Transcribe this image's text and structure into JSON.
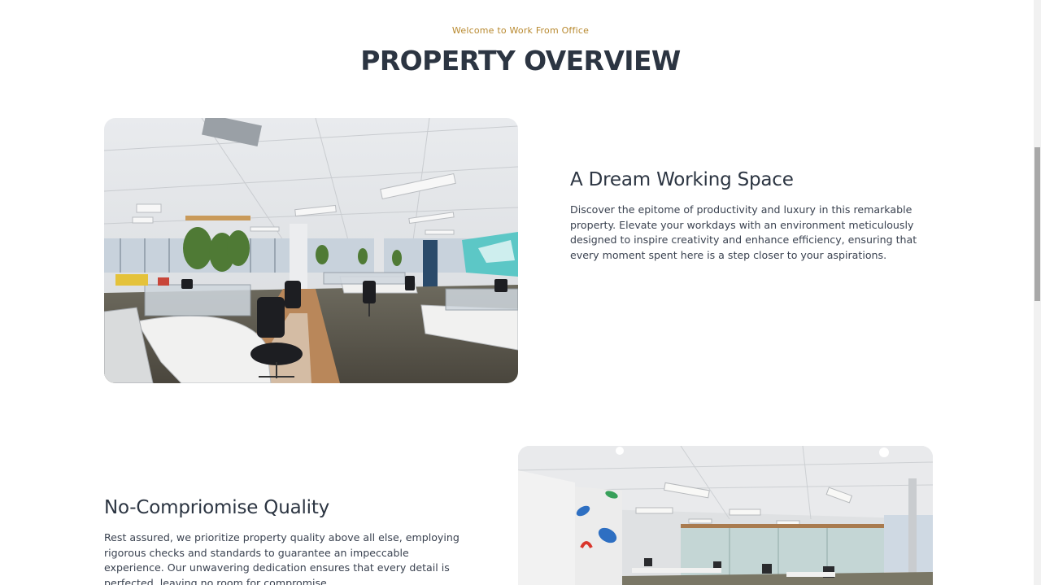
{
  "section": {
    "eyebrow": "Welcome to Work From Office",
    "title": "PROPERTY OVERVIEW"
  },
  "features": [
    {
      "title": "A Dream Working Space",
      "text": "Discover the epitome of productivity and luxury in this remarkable property. Elevate your workdays with an environment meticulously designed to inspire creativity and enhance efficiency, ensuring that every moment spent here is a step closer to your aspirations."
    },
    {
      "title": "No-Compriomise Quality",
      "text": "Rest assured, we prioritize property quality above all else, employing rigorous checks and standards to guarantee an impeccable experience. Our unwavering dedication ensures that every detail is perfected, leaving no room for compromise."
    }
  ],
  "colors": {
    "accent": "#b8892f",
    "heading": "#2c3542",
    "body_text": "#3a4250"
  }
}
